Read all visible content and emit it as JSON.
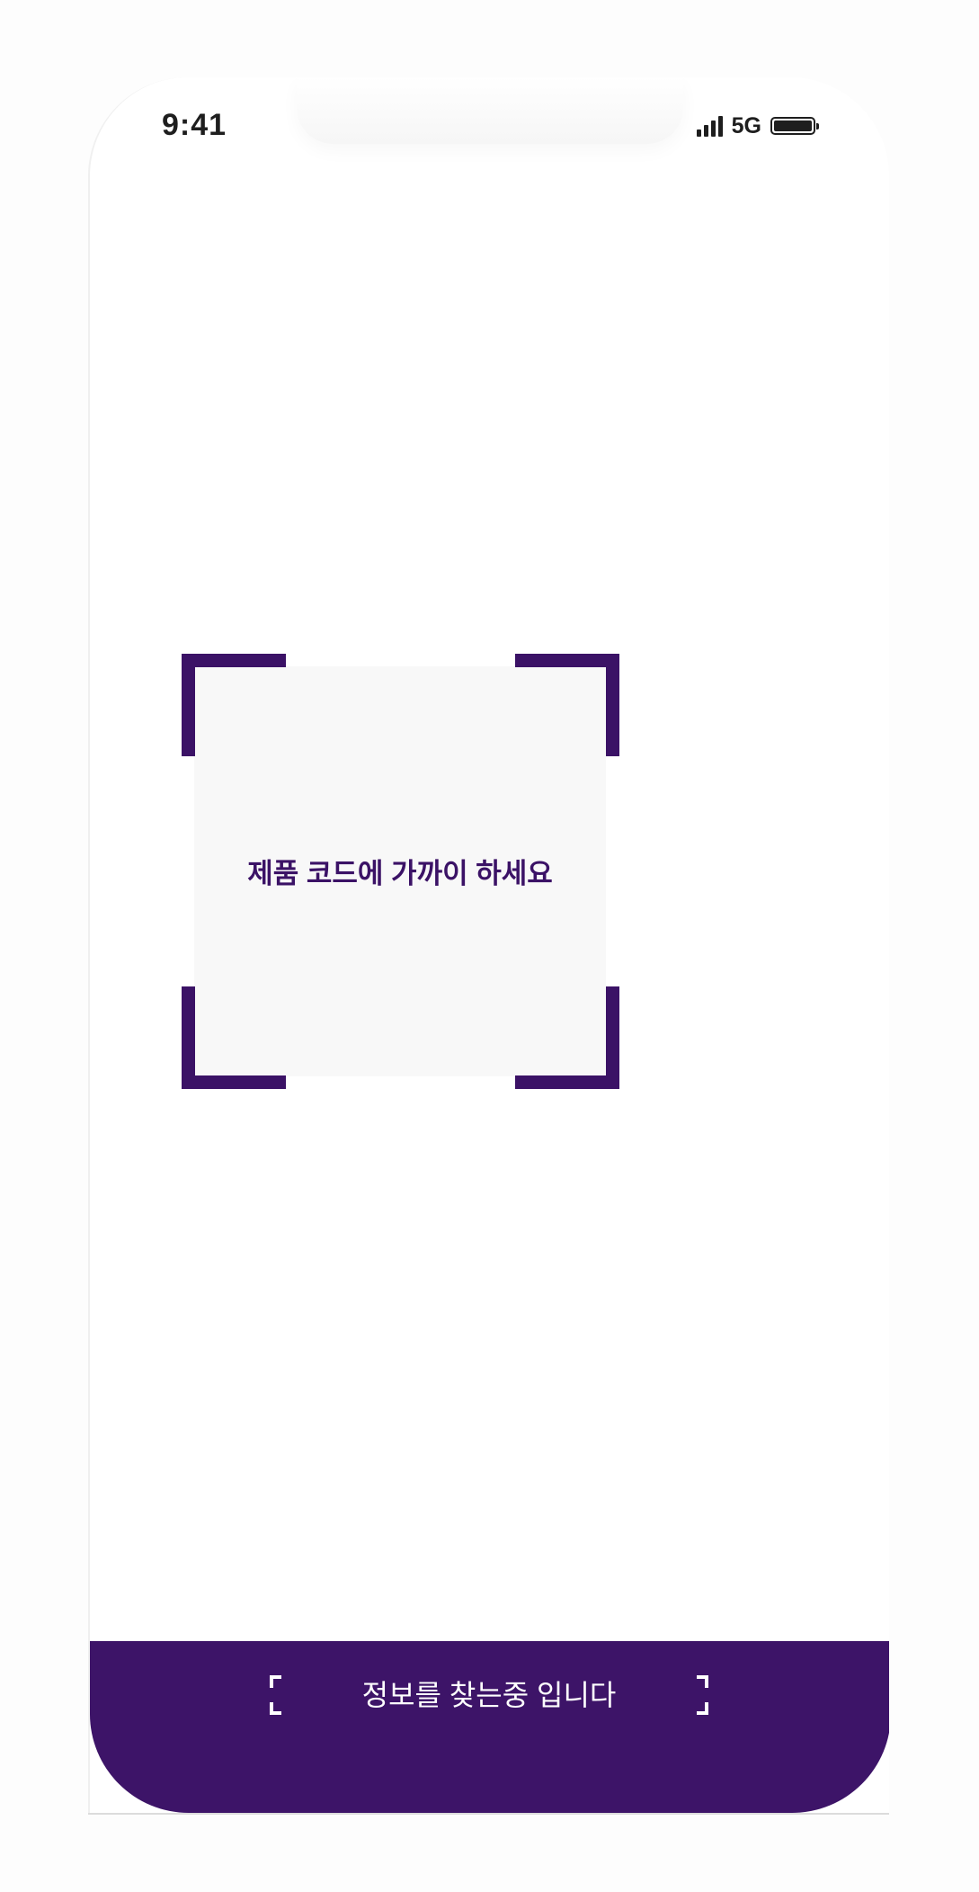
{
  "status_bar": {
    "time": "9:41",
    "network": "5G"
  },
  "scanner": {
    "instruction": "제품 코드에 가까이 하세요",
    "frame_color": "#3b1266"
  },
  "bottom_bar": {
    "status_text": "정보를 찾는중 입니다",
    "background_color": "#3d1468"
  },
  "icons": [
    "signal-icon",
    "battery-icon",
    "scan-corner-icon"
  ]
}
